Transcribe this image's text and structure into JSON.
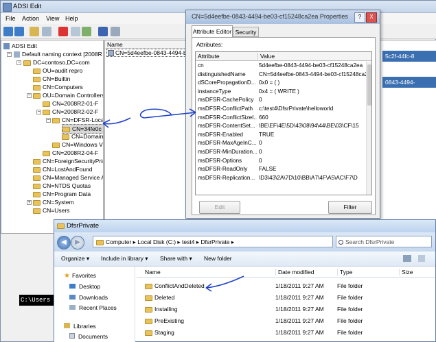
{
  "adsi": {
    "title": "ADSI Edit",
    "menu": [
      "File",
      "Action",
      "View",
      "Help"
    ],
    "tree": [
      {
        "label": "ADSI Edit",
        "depth": 0
      },
      {
        "label": "Default naming context [2008R",
        "depth": 1
      },
      {
        "label": "DC=contoso,DC=com",
        "depth": 2
      },
      {
        "label": "OU=audit repro",
        "depth": 3
      },
      {
        "label": "CN=Builtin",
        "depth": 3
      },
      {
        "label": "CN=Computers",
        "depth": 3
      },
      {
        "label": "OU=Domain Controllers",
        "depth": 3
      },
      {
        "label": "CN=2008R2-01-F",
        "depth": 4
      },
      {
        "label": "CN=2008R2-02-F",
        "depth": 4
      },
      {
        "label": "CN=DFSR-Loca",
        "depth": 5
      },
      {
        "label": "CN=34fe0c",
        "depth": 6,
        "selected": true
      },
      {
        "label": "CN=Domain",
        "depth": 6
      },
      {
        "label": "CN=Windows V",
        "depth": 5
      },
      {
        "label": "CN=2008R2-04-F",
        "depth": 4
      },
      {
        "label": "CN=ForeignSecurityPrin",
        "depth": 3
      },
      {
        "label": "CN=LostAndFound",
        "depth": 3
      },
      {
        "label": "CN=Managed Service A",
        "depth": 3
      },
      {
        "label": "CN=NTDS Quotas",
        "depth": 3
      },
      {
        "label": "CN=Program Data",
        "depth": 3
      },
      {
        "label": "CN=System",
        "depth": 3
      },
      {
        "label": "CN=Users",
        "depth": 3
      }
    ],
    "list_header": "Name",
    "list_row": "CN=5d4eefbe-0843-4494-be",
    "right_frag1": "5c2f-44fc-8",
    "right_frag2": "0843-4494-"
  },
  "props": {
    "title": "CN=5d4eefbe-0843-4494-be03-cf15248ca2ea Properties",
    "help_btn": "?",
    "close_btn": "X",
    "tabs": [
      "Attribute Editor",
      "Security"
    ],
    "attributes_label": "Attributes:",
    "col_attribute": "Attribute",
    "col_value": "Value",
    "rows": [
      {
        "attr": "cn",
        "value": "5d4eefbe-0843-4494-be03-cf15248ca2ea"
      },
      {
        "attr": "distinguishedName",
        "value": "CN=5d4eefbe-0843-4494-be03-cf15248ca2e"
      },
      {
        "attr": "dSCorePropagationD...",
        "value": "0x0 = ( )"
      },
      {
        "attr": "instanceType",
        "value": "0x4 = ( WRITE )"
      },
      {
        "attr": "msDFSR-CachePolicy",
        "value": "0"
      },
      {
        "attr": "msDFSR-ConflictPath",
        "value": "c:\\test4\\DfsrPrivate\\helloworld"
      },
      {
        "attr": "msDFSR-ConflictSizeI...",
        "value": "660"
      },
      {
        "attr": "msDFSR-ContentSet...",
        "value": "\\BE\\EF\\4E\\5D\\43\\08\\94\\44\\BE\\03\\CF\\15"
      },
      {
        "attr": "msDFSR-Enabled",
        "value": "TRUE"
      },
      {
        "attr": "msDFSR-MaxAgeInC...",
        "value": "0"
      },
      {
        "attr": "msDFSR-MinDuration...",
        "value": "0"
      },
      {
        "attr": "msDFSR-Options",
        "value": "0"
      },
      {
        "attr": "msDFSR-ReadOnly",
        "value": "FALSE"
      },
      {
        "attr": "msDFSR-Replication...",
        "value": "\\D3\\43\\2A\\7D\\10\\BB\\A7\\4F\\A5\\AC\\F7\\D"
      }
    ],
    "edit_btn": "Edit",
    "filter_btn": "Filter"
  },
  "explorer": {
    "title": "DfsrPrivate",
    "address": "Computer ▸ Local Disk (C:) ▸ test4 ▸ DfsrPrivate ▸",
    "search_placeholder": "Search DfsrPrivate",
    "commands": [
      "Organize ▾",
      "Include in library ▾",
      "Share with ▾",
      "New folder"
    ],
    "nav": [
      "Favorites",
      "Desktop",
      "Downloads",
      "Recent Places",
      "Libraries",
      "Documents"
    ],
    "columns": [
      "Name",
      "Date modified",
      "Type",
      "Size"
    ],
    "files": [
      {
        "name": "ConflictAndDeleted",
        "date": "1/18/2011 9:27 AM",
        "type": "File folder"
      },
      {
        "name": "Deleted",
        "date": "1/18/2011 9:27 AM",
        "type": "File folder"
      },
      {
        "name": "Installing",
        "date": "1/18/2011 9:27 AM",
        "type": "File folder"
      },
      {
        "name": "PreExisting",
        "date": "1/18/2011 9:27 AM",
        "type": "File folder"
      },
      {
        "name": "Staging",
        "date": "1/18/2011 9:27 AM",
        "type": "File folder"
      }
    ]
  },
  "console_text": "C:\\Users"
}
